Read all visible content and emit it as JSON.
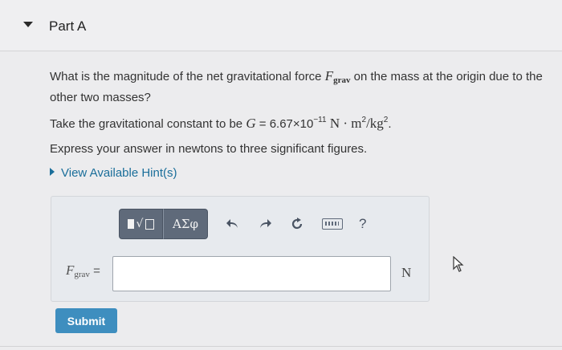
{
  "part": {
    "title": "Part A"
  },
  "question": {
    "text_before": "What is the magnitude of the net gravitational force ",
    "var_symbol": "F",
    "var_subscript": "grav",
    "text_after": " on the mass at the origin due to the other two masses?"
  },
  "constant": {
    "prefix": "Take the gravitational constant to be ",
    "g_symbol": "G",
    "equals_value": " = 6.67×10",
    "exponent": "−11",
    "units_main": " N · m",
    "units_exp1": "2",
    "units_div": "/kg",
    "units_exp2": "2",
    "suffix": "."
  },
  "instructions": "Express your answer in newtons to three significant figures.",
  "hints_link": "View Available Hint(s)",
  "toolbar": {
    "symbols_label": "ΑΣφ",
    "help_label": "?",
    "icons": [
      "templates-icon",
      "undo-icon",
      "redo-icon",
      "reset-icon",
      "keyboard-icon",
      "help-icon"
    ]
  },
  "answer": {
    "var_symbol": "F",
    "var_subscript": "grav",
    "equals": " =",
    "value": "",
    "unit": "N"
  },
  "submit_label": "Submit",
  "colors": {
    "link": "#1a6e9a",
    "submit": "#3e8ebf",
    "toolbar": "#5f6a7a"
  }
}
